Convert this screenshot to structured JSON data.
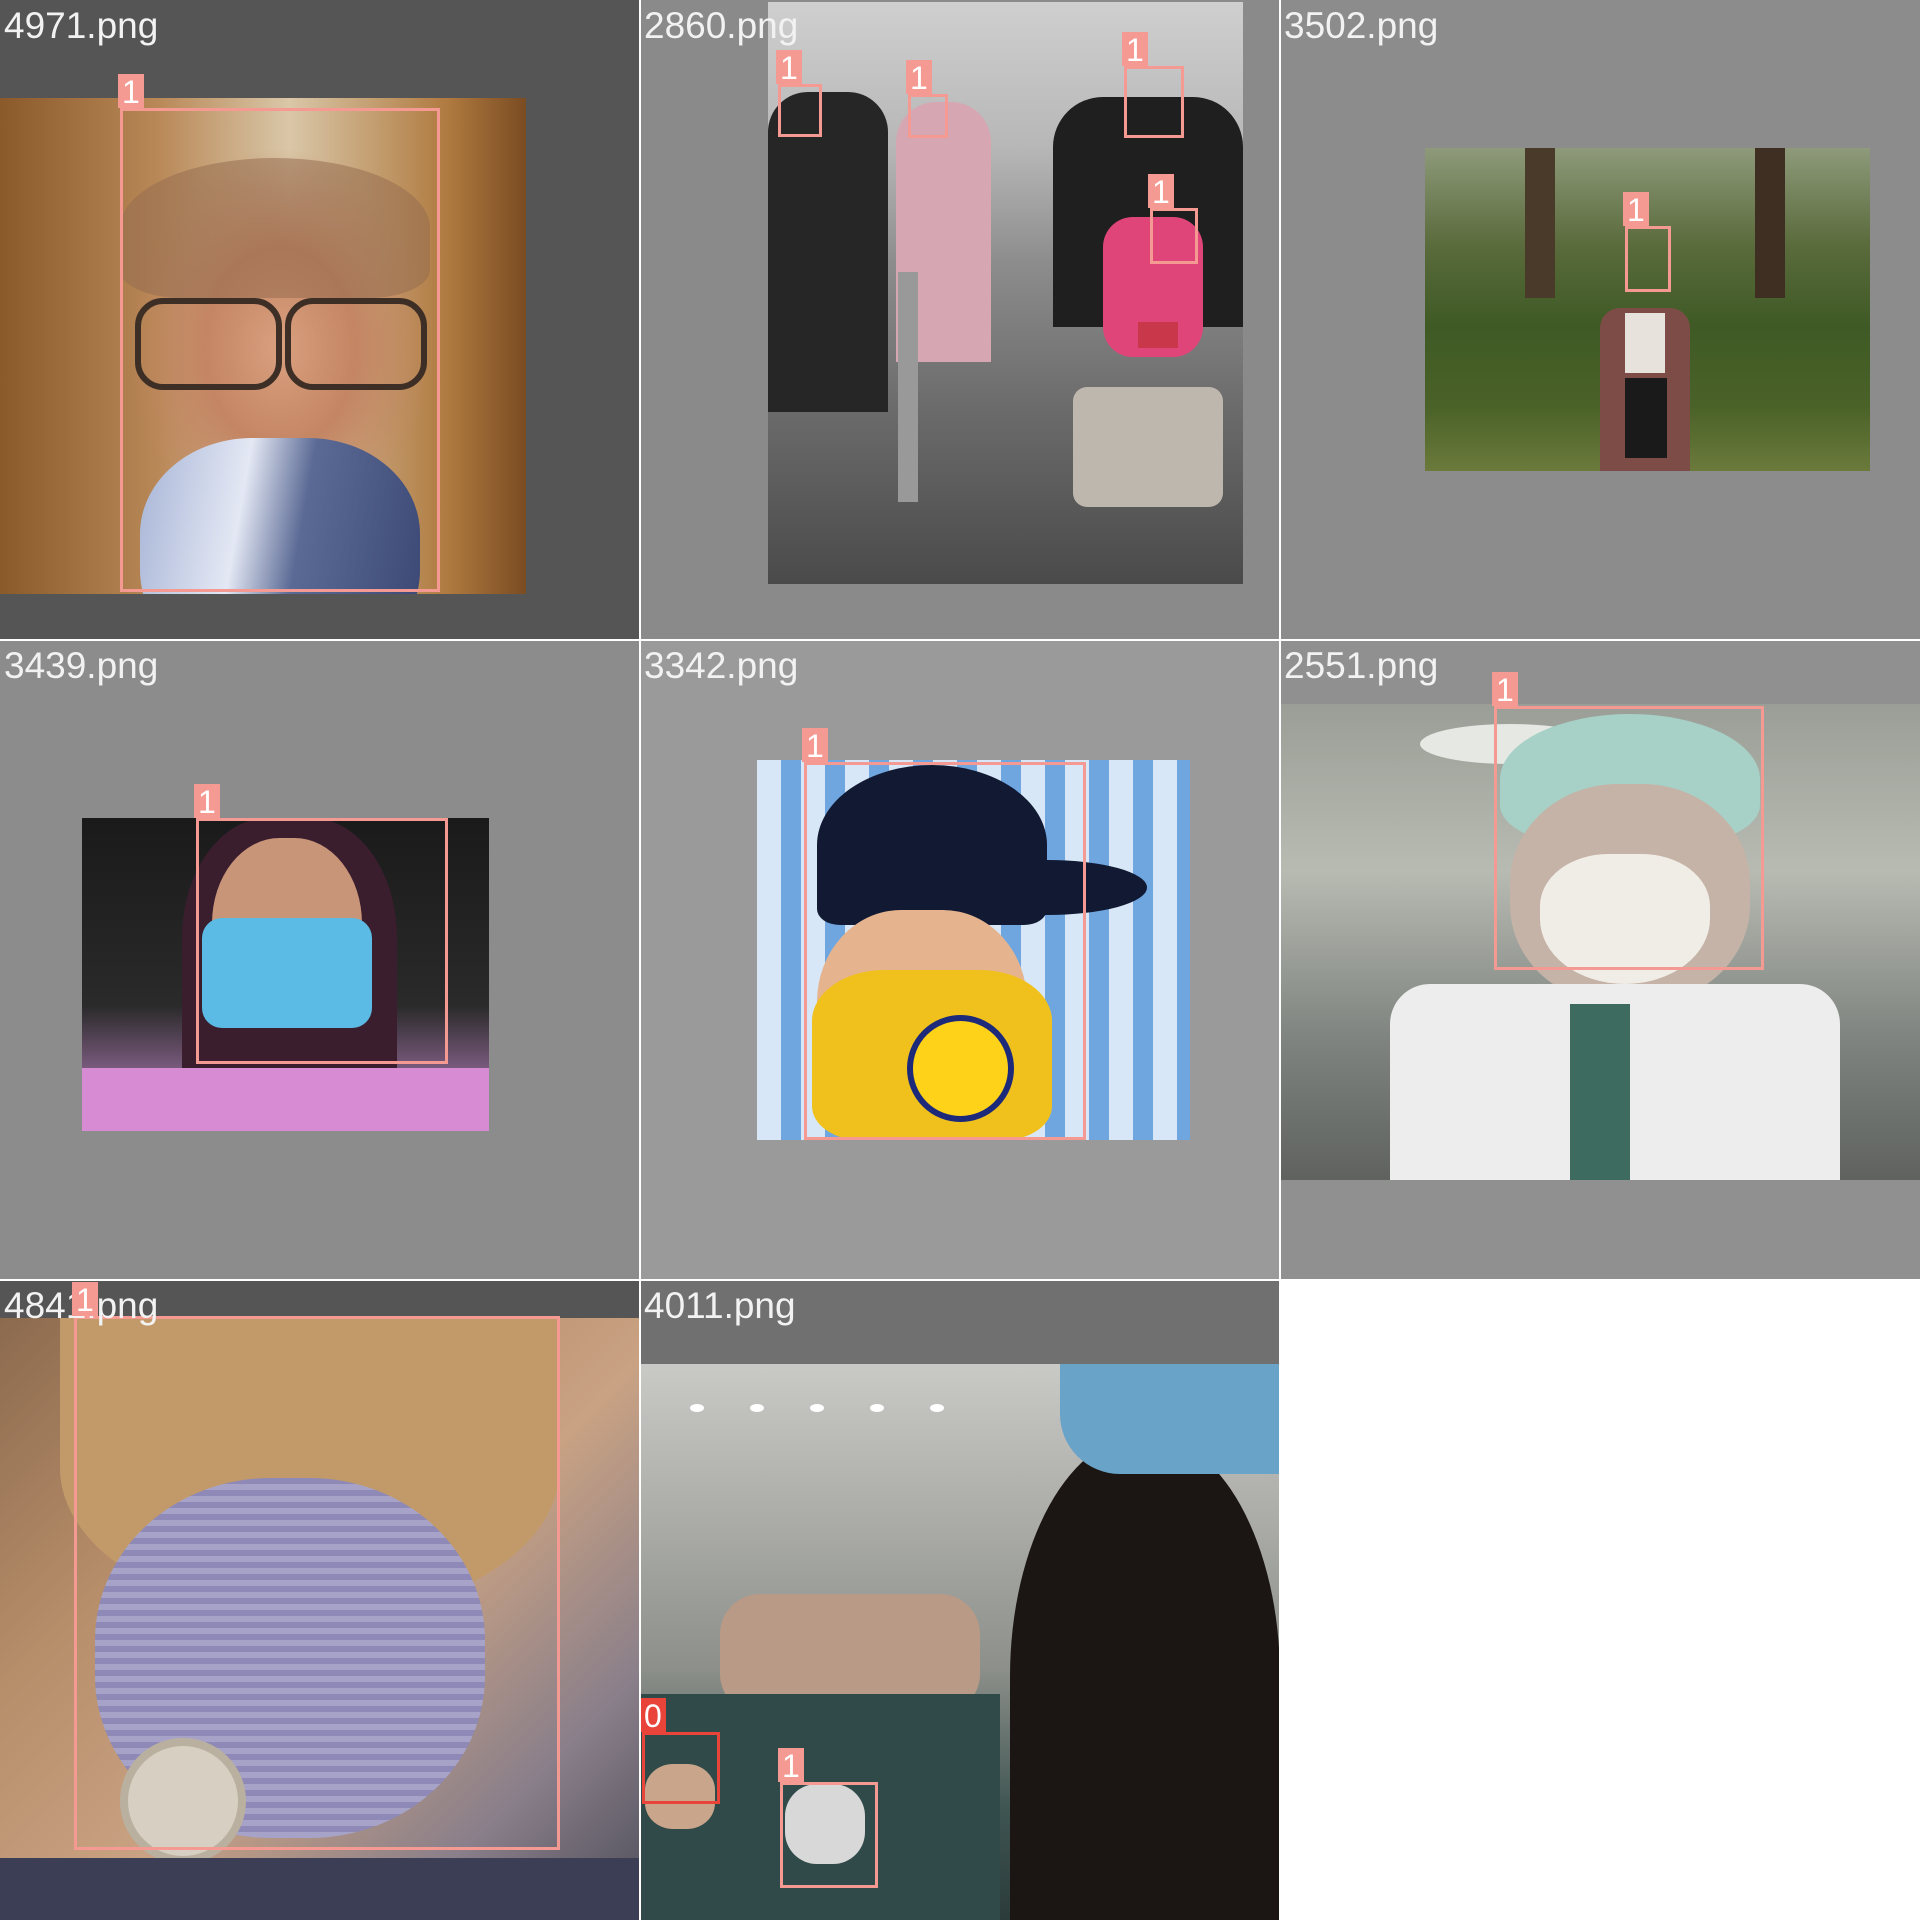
{
  "colors": {
    "class_1": "#f59a92",
    "class_0": "#e8443a",
    "label_text": "#ffffff",
    "filename_text": "#f2f2f2"
  },
  "tiles": [
    {
      "filename": "4971.png",
      "boxes": [
        {
          "label": "1"
        }
      ]
    },
    {
      "filename": "2860.png",
      "boxes": [
        {
          "label": "1"
        },
        {
          "label": "1"
        },
        {
          "label": "1"
        },
        {
          "label": "1"
        }
      ]
    },
    {
      "filename": "3502.png",
      "boxes": [
        {
          "label": "1"
        }
      ]
    },
    {
      "filename": "3439.png",
      "boxes": [
        {
          "label": "1"
        }
      ]
    },
    {
      "filename": "3342.png",
      "boxes": [
        {
          "label": "1"
        }
      ]
    },
    {
      "filename": "2551.png",
      "boxes": [
        {
          "label": "1"
        }
      ]
    },
    {
      "filename": "4841.png",
      "boxes": [
        {
          "label": "1"
        }
      ]
    },
    {
      "filename": "4011.png",
      "boxes": [
        {
          "label": "0"
        },
        {
          "label": "1"
        }
      ]
    }
  ]
}
